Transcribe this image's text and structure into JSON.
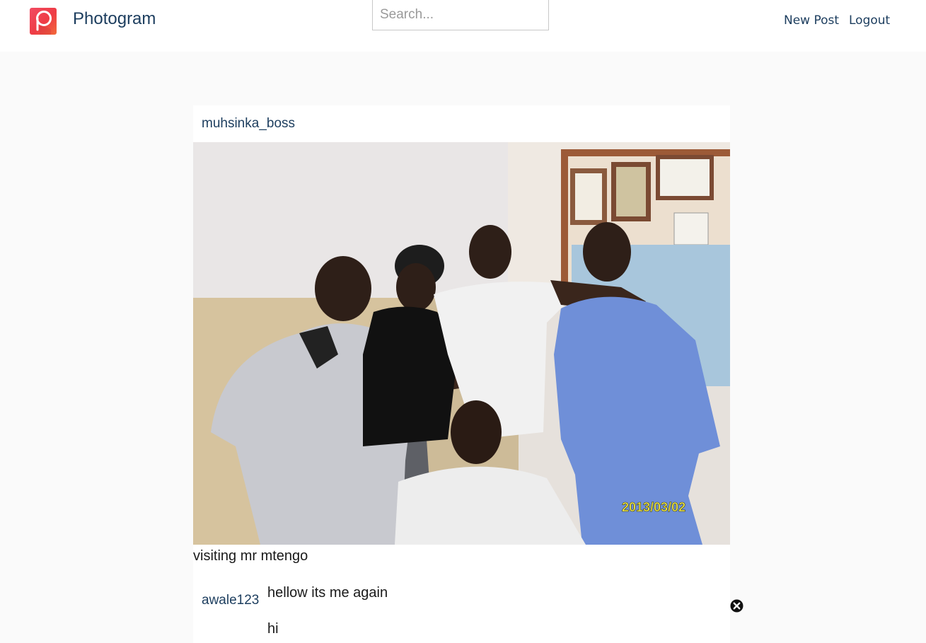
{
  "navbar": {
    "brand_name": "Photogram",
    "logo_icon": "photogram-p-logo-icon",
    "search_placeholder": "Search...",
    "links": {
      "new_post": "New Post",
      "logout": "Logout"
    }
  },
  "post": {
    "author": "muhsinka_boss",
    "image_date_stamp": "2013/03/02",
    "caption": "visiting mr mtengo",
    "comments": [
      {
        "author": "awale123",
        "text": "hellow its me again"
      },
      {
        "author": "",
        "text": "hi"
      }
    ],
    "delete_icon": "close-circle-icon"
  },
  "colors": {
    "page_background": "#fafafa",
    "surface": "#ffffff",
    "link": "#1c3d5e",
    "logo_gradient_start": "#f24b62",
    "logo_gradient_end": "#f26a3a"
  }
}
